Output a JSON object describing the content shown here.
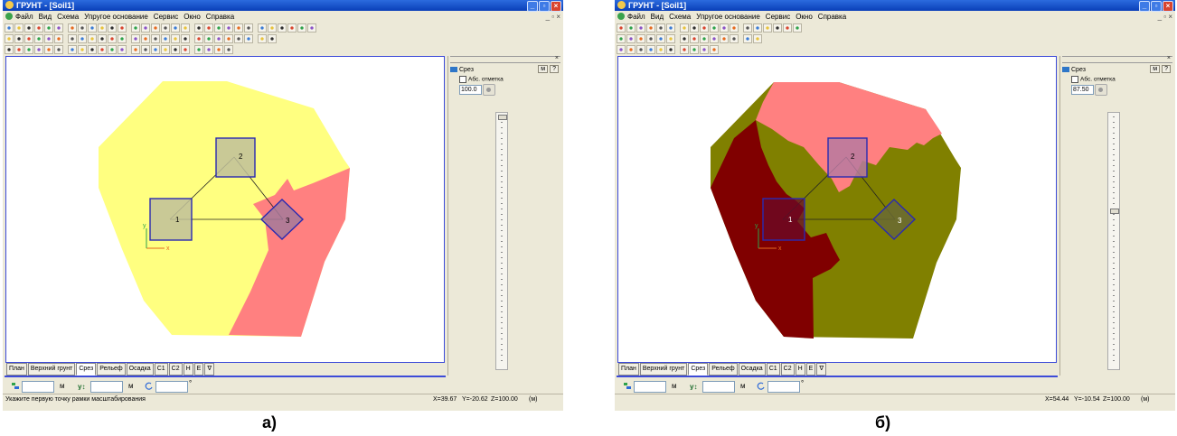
{
  "panels": [
    {
      "id": "a",
      "title": "ГРУНТ - [Soil1]",
      "menu": [
        "Файл",
        "Вид",
        "Схема",
        "Упругое основание",
        "Сервис",
        "Окно",
        "Справка"
      ],
      "tabs": [
        "План",
        "Верхний грунт",
        "Срез",
        "Рельеф",
        "Осадка",
        "C1",
        "C2",
        "H",
        "E",
        "∇"
      ],
      "active_tab": "Срез",
      "side": {
        "title": "Срез",
        "unit": "м",
        "help": "?",
        "checkbox_label": "Абс. отметка",
        "elevation": "100.0",
        "slider_level": 0.0
      },
      "coords": {
        "dx_unit": "м",
        "dy_unit": "м",
        "angle_unit": "°"
      },
      "status": {
        "hint": "Укажите первую точку рамки масштабирования",
        "x": "X=39.67",
        "y": "Y=-20.62",
        "z": "Z=100.00",
        "unit": "(м)"
      },
      "markers": [
        "1",
        "2",
        "3"
      ],
      "axes": {
        "x": "x",
        "y": "y"
      },
      "colors": {
        "layer_a": "#ffff80",
        "layer_b": "#ff8080",
        "pile_fill": "#bfbf9a",
        "frame": "#2a2ab0"
      },
      "caption": "а)"
    },
    {
      "id": "b",
      "title": "ГРУНТ - [Soil1]",
      "menu": [
        "Файл",
        "Вид",
        "Схема",
        "Упругое основание",
        "Сервис",
        "Окно",
        "Справка"
      ],
      "tabs": [
        "План",
        "Верхний грунт",
        "Срез",
        "Рельеф",
        "Осадка",
        "C1",
        "C2",
        "H",
        "E",
        "∇"
      ],
      "active_tab": "Срез",
      "side": {
        "title": "Срез",
        "unit": "м",
        "help": "?",
        "checkbox_label": "Абс. отметка",
        "elevation": "87.50",
        "slider_level": 0.38
      },
      "coords": {
        "dx_unit": "м",
        "dy_unit": "м",
        "angle_unit": "°"
      },
      "status": {
        "hint": "",
        "x": "X=54.44",
        "y": "Y=-10.54",
        "z": "Z=100.00",
        "unit": "(м)"
      },
      "markers": [
        "1",
        "2",
        "3"
      ],
      "axes": {
        "x": "x",
        "y": "y"
      },
      "colors": {
        "layer_a": "#808000",
        "layer_b": "#800000",
        "layer_c": "#ff8080",
        "frame": "#2a2ab0"
      },
      "caption": "б)"
    }
  ]
}
